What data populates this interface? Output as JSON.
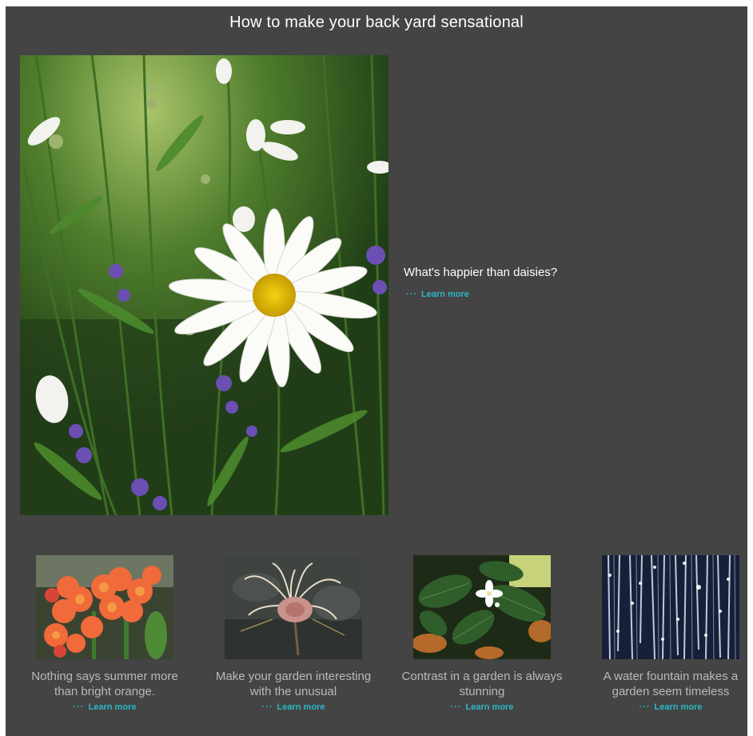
{
  "page": {
    "title": "How to make your back yard sensational"
  },
  "hero": {
    "image_name": "daisy-photo",
    "caption": "What's happier than daisies?",
    "learn_more_dots": "···",
    "learn_more_label": "Learn more"
  },
  "cards": [
    {
      "image_name": "orange-flowers-photo",
      "caption": "Nothing says summer more than bright orange.",
      "learn_more_dots": "···",
      "learn_more_label": "Learn more"
    },
    {
      "image_name": "unusual-flower-photo",
      "caption": "Make your garden interesting with the unusual",
      "learn_more_dots": "···",
      "learn_more_label": "Learn more"
    },
    {
      "image_name": "contrast-leaves-photo",
      "caption": "Contrast in a garden is always stunning",
      "learn_more_dots": "···",
      "learn_more_label": "Learn more"
    },
    {
      "image_name": "water-fountain-photo",
      "caption": "A water fountain makes a garden seem timeless",
      "learn_more_dots": "···",
      "learn_more_label": "Learn more"
    }
  ],
  "colors": {
    "background": "#444444",
    "accent": "#2bb7c7",
    "caption_muted": "#b9b9b9"
  }
}
